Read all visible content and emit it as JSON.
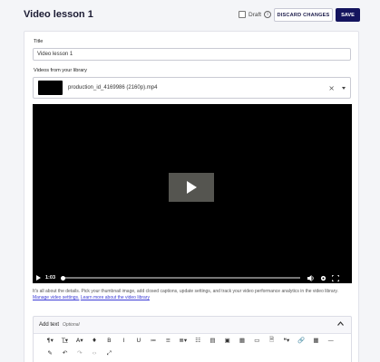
{
  "header": {
    "title": "Video lesson 1",
    "draft_label": "Draft",
    "info_icon": "i",
    "discard_label": "DISCARD CHANGES",
    "save_label": "SAVE"
  },
  "form": {
    "title_label": "Title",
    "title_value": "Video lesson 1",
    "videos_label": "Videos from your library",
    "selected_video": "production_id_4169986 (2160p).mp4",
    "clear_glyph": "×"
  },
  "player": {
    "current_time": "1:03",
    "progress_fraction": 0.0
  },
  "help": {
    "text": "It's all about the details. Pick your thumbnail image, add closed captions, update settings, and track your video performance analytics in the video library.",
    "link_manage": "Manage video settings.",
    "link_learn": "Learn more about the video library"
  },
  "editor": {
    "title": "Add text",
    "optional": "Optional",
    "toolbar_row1": [
      "¶▾",
      "T͟▾",
      "A▾",
      "♦",
      "B",
      "I",
      "U",
      "≔",
      "≡",
      "≣▾",
      "☷",
      "▤",
      "▣",
      "▦",
      "▭",
      "🗎",
      "❝▾",
      "🔗",
      "▦",
      "—"
    ],
    "toolbar_row2": [
      "✎",
      "↶",
      "↷",
      "‹›",
      "⤢"
    ],
    "toolbar_row2_dim": [
      false,
      false,
      true,
      true,
      false
    ]
  },
  "colors": {
    "primary": "#14145e",
    "link": "#3b3bd6",
    "background": "#f4f5f8"
  }
}
